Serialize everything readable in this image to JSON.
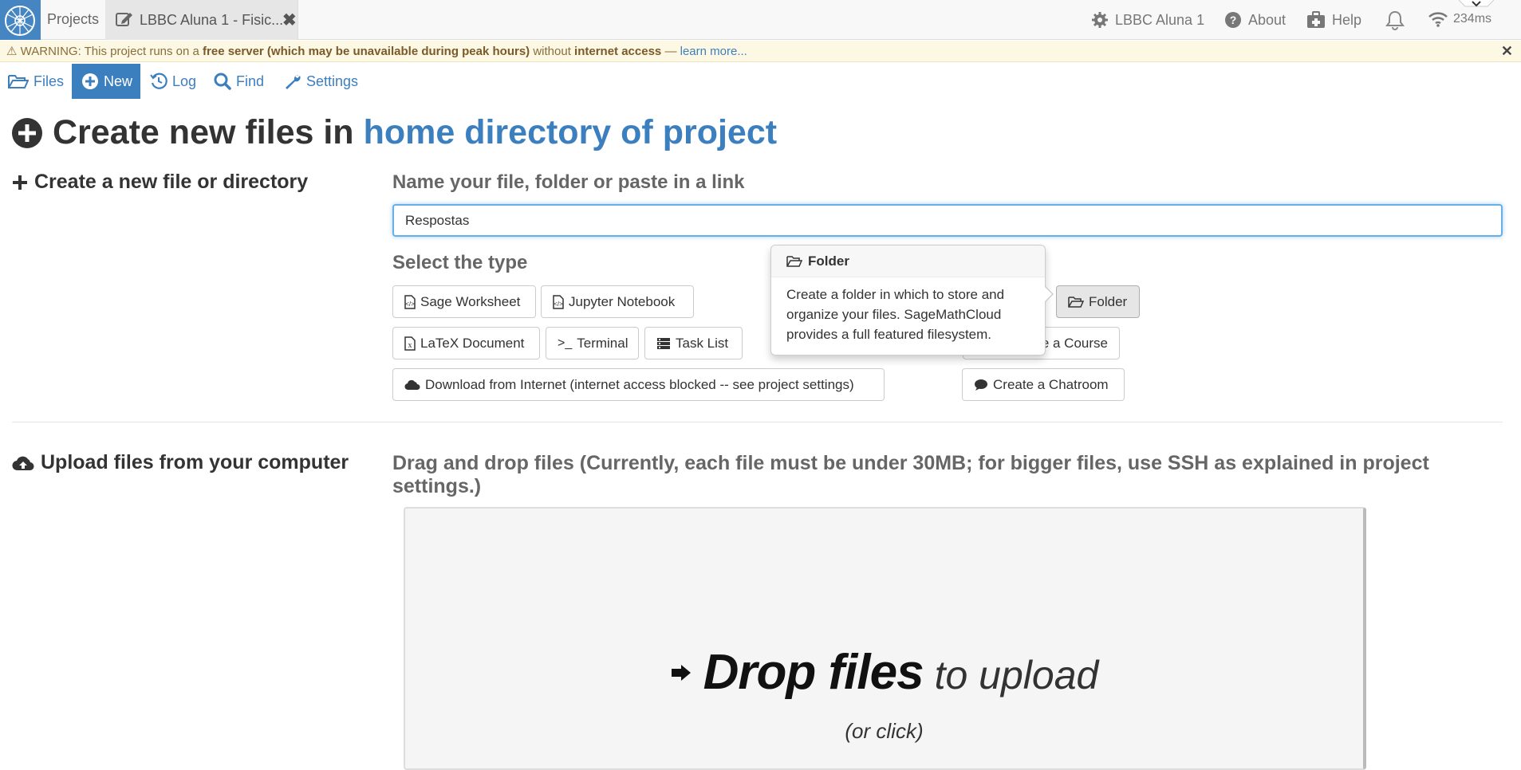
{
  "topbar": {
    "projects_label": "Projects",
    "project_tab_title": "LBBC Aluna 1 - Fisic...",
    "project_settings_label": "LBBC Aluna 1",
    "about_label": "About",
    "help_label": "Help",
    "ping_label": "234ms"
  },
  "warning": {
    "prefix": "WARNING: This project runs on a ",
    "bold1": "free server (which may be unavailable during peak hours)",
    "middle": " without ",
    "bold2": "internet access",
    "dash": " — ",
    "link": "learn more..."
  },
  "project_nav": {
    "files": "Files",
    "new": "New",
    "log": "Log",
    "find": "Find",
    "settings": "Settings"
  },
  "heading": {
    "prefix": "Create new files in",
    "location": "home directory of project"
  },
  "create_section": {
    "title": "Create a new file or directory",
    "name_label": "Name your file, folder or paste in a link",
    "name_value": "Respostas",
    "type_label": "Select the type",
    "buttons": {
      "sage": "Sage Worksheet",
      "jupyter": "Jupyter Notebook",
      "folder": "Folder",
      "latex": "LaTeX Document",
      "terminal": "Terminal",
      "task": "Task List",
      "course": "e a Course",
      "download": "Download from Internet (internet access blocked -- see project settings)",
      "chatroom": "Create a Chatroom"
    }
  },
  "popover": {
    "title": "Folder",
    "body": "Create a folder in which to store and organize your files. SageMathCloud provides a full featured filesystem."
  },
  "upload_section": {
    "title": "Upload files from your computer",
    "drop_title": "Drag and drop files (Currently, each file must be under 30MB; for bigger files, use SSH as explained in project settings.)",
    "drop_bold": "Drop files",
    "drop_light": "to upload",
    "drop_sub": "(or click)"
  },
  "colors": {
    "accent": "#3c7fbf",
    "warning_bg": "#fcf8e3",
    "logo_bg": "#4586c2"
  }
}
